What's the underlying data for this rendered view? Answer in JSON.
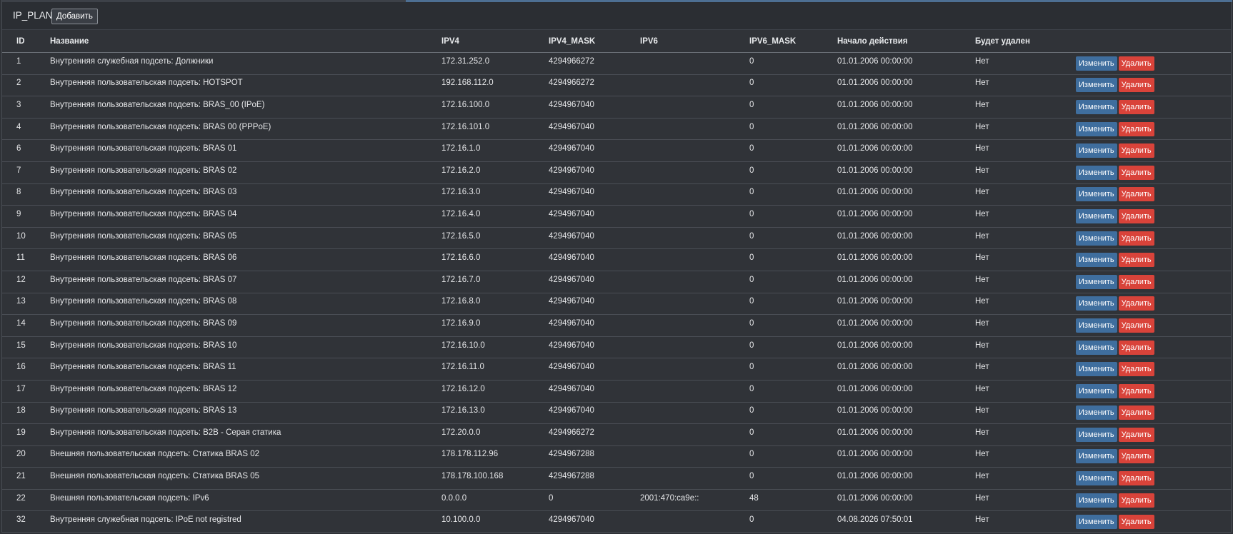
{
  "header": {
    "title": "IP_PLAN",
    "add_label": "Добавить"
  },
  "table": {
    "columns": [
      "ID",
      "Название",
      "IPV4",
      "IPV4_MASK",
      "IPV6",
      "IPV6_MASK",
      "Начало действия",
      "Будет удален",
      ""
    ],
    "edit_label": "Изменить",
    "delete_label": "Удалить",
    "rows": [
      {
        "id": "1",
        "name": "Внутренняя служебная подсеть: Должники",
        "ipv4": "172.31.252.0",
        "ipv4_mask": "4294966272",
        "ipv6": "",
        "ipv6_mask": "0",
        "start": "01.01.2006 00:00:00",
        "deleted": "Нет"
      },
      {
        "id": "2",
        "name": "Внутренняя пользовательская подсеть: HOTSPOT",
        "ipv4": "192.168.112.0",
        "ipv4_mask": "4294966272",
        "ipv6": "",
        "ipv6_mask": "0",
        "start": "01.01.2006 00:00:00",
        "deleted": "Нет"
      },
      {
        "id": "3",
        "name": "Внутренняя пользовательская подсеть: BRAS_00 (IPoE)",
        "ipv4": "172.16.100.0",
        "ipv4_mask": "4294967040",
        "ipv6": "",
        "ipv6_mask": "0",
        "start": "01.01.2006 00:00:00",
        "deleted": "Нет"
      },
      {
        "id": "4",
        "name": "Внутренняя пользовательская подсеть: BRAS 00 (PPPoE)",
        "ipv4": "172.16.101.0",
        "ipv4_mask": "4294967040",
        "ipv6": "",
        "ipv6_mask": "0",
        "start": "01.01.2006 00:00:00",
        "deleted": "Нет"
      },
      {
        "id": "6",
        "name": "Внутренняя пользовательская подсеть: BRAS 01",
        "ipv4": "172.16.1.0",
        "ipv4_mask": "4294967040",
        "ipv6": "",
        "ipv6_mask": "0",
        "start": "01.01.2006 00:00:00",
        "deleted": "Нет"
      },
      {
        "id": "7",
        "name": "Внутренняя пользовательская подсеть: BRAS 02",
        "ipv4": "172.16.2.0",
        "ipv4_mask": "4294967040",
        "ipv6": "",
        "ipv6_mask": "0",
        "start": "01.01.2006 00:00:00",
        "deleted": "Нет"
      },
      {
        "id": "8",
        "name": "Внутренняя пользовательская подсеть: BRAS 03",
        "ipv4": "172.16.3.0",
        "ipv4_mask": "4294967040",
        "ipv6": "",
        "ipv6_mask": "0",
        "start": "01.01.2006 00:00:00",
        "deleted": "Нет"
      },
      {
        "id": "9",
        "name": "Внутренняя пользовательская подсеть: BRAS 04",
        "ipv4": "172.16.4.0",
        "ipv4_mask": "4294967040",
        "ipv6": "",
        "ipv6_mask": "0",
        "start": "01.01.2006 00:00:00",
        "deleted": "Нет"
      },
      {
        "id": "10",
        "name": "Внутренняя пользовательская подсеть: BRAS 05",
        "ipv4": "172.16.5.0",
        "ipv4_mask": "4294967040",
        "ipv6": "",
        "ipv6_mask": "0",
        "start": "01.01.2006 00:00:00",
        "deleted": "Нет"
      },
      {
        "id": "11",
        "name": "Внутренняя пользовательская подсеть: BRAS 06",
        "ipv4": "172.16.6.0",
        "ipv4_mask": "4294967040",
        "ipv6": "",
        "ipv6_mask": "0",
        "start": "01.01.2006 00:00:00",
        "deleted": "Нет"
      },
      {
        "id": "12",
        "name": "Внутренняя пользовательская подсеть: BRAS 07",
        "ipv4": "172.16.7.0",
        "ipv4_mask": "4294967040",
        "ipv6": "",
        "ipv6_mask": "0",
        "start": "01.01.2006 00:00:00",
        "deleted": "Нет"
      },
      {
        "id": "13",
        "name": "Внутренняя пользовательская подсеть: BRAS 08",
        "ipv4": "172.16.8.0",
        "ipv4_mask": "4294967040",
        "ipv6": "",
        "ipv6_mask": "0",
        "start": "01.01.2006 00:00:00",
        "deleted": "Нет"
      },
      {
        "id": "14",
        "name": "Внутренняя пользовательская подсеть: BRAS 09",
        "ipv4": "172.16.9.0",
        "ipv4_mask": "4294967040",
        "ipv6": "",
        "ipv6_mask": "0",
        "start": "01.01.2006 00:00:00",
        "deleted": "Нет"
      },
      {
        "id": "15",
        "name": "Внутренняя пользовательская подсеть: BRAS 10",
        "ipv4": "172.16.10.0",
        "ipv4_mask": "4294967040",
        "ipv6": "",
        "ipv6_mask": "0",
        "start": "01.01.2006 00:00:00",
        "deleted": "Нет"
      },
      {
        "id": "16",
        "name": "Внутренняя пользовательская подсеть: BRAS 11",
        "ipv4": "172.16.11.0",
        "ipv4_mask": "4294967040",
        "ipv6": "",
        "ipv6_mask": "0",
        "start": "01.01.2006 00:00:00",
        "deleted": "Нет"
      },
      {
        "id": "17",
        "name": "Внутренняя пользовательская подсеть: BRAS 12",
        "ipv4": "172.16.12.0",
        "ipv4_mask": "4294967040",
        "ipv6": "",
        "ipv6_mask": "0",
        "start": "01.01.2006 00:00:00",
        "deleted": "Нет"
      },
      {
        "id": "18",
        "name": "Внутренняя пользовательская подсеть: BRAS 13",
        "ipv4": "172.16.13.0",
        "ipv4_mask": "4294967040",
        "ipv6": "",
        "ipv6_mask": "0",
        "start": "01.01.2006 00:00:00",
        "deleted": "Нет"
      },
      {
        "id": "19",
        "name": "Внутренняя пользовательская подсеть: B2B - Серая статика",
        "ipv4": "172.20.0.0",
        "ipv4_mask": "4294966272",
        "ipv6": "",
        "ipv6_mask": "0",
        "start": "01.01.2006 00:00:00",
        "deleted": "Нет"
      },
      {
        "id": "20",
        "name": "Внешняя пользовательская подсеть: Статика BRAS 02",
        "ipv4": "178.178.112.96",
        "ipv4_mask": "4294967288",
        "ipv6": "",
        "ipv6_mask": "0",
        "start": "01.01.2006 00:00:00",
        "deleted": "Нет"
      },
      {
        "id": "21",
        "name": "Внешняя пользовательская подсеть: Статика BRAS 05",
        "ipv4": "178.178.100.168",
        "ipv4_mask": "4294967288",
        "ipv6": "",
        "ipv6_mask": "0",
        "start": "01.01.2006 00:00:00",
        "deleted": "Нет"
      },
      {
        "id": "22",
        "name": "Внешняя пользовательская подсеть: IPv6",
        "ipv4": "0.0.0.0",
        "ipv4_mask": "0",
        "ipv6": "2001:470:ca9e::",
        "ipv6_mask": "48",
        "start": "01.01.2006 00:00:00",
        "deleted": "Нет"
      },
      {
        "id": "32",
        "name": "Внутренняя служебная подсеть: IPoE not registred",
        "ipv4": "10.100.0.0",
        "ipv4_mask": "4294967040",
        "ipv6": "",
        "ipv6_mask": "0",
        "start": "04.08.2026 07:50:01",
        "deleted": "Нет"
      }
    ]
  },
  "colors": {
    "background": "#303338",
    "edit_button": "#3f6e9e",
    "delete_button": "#d9433a"
  }
}
